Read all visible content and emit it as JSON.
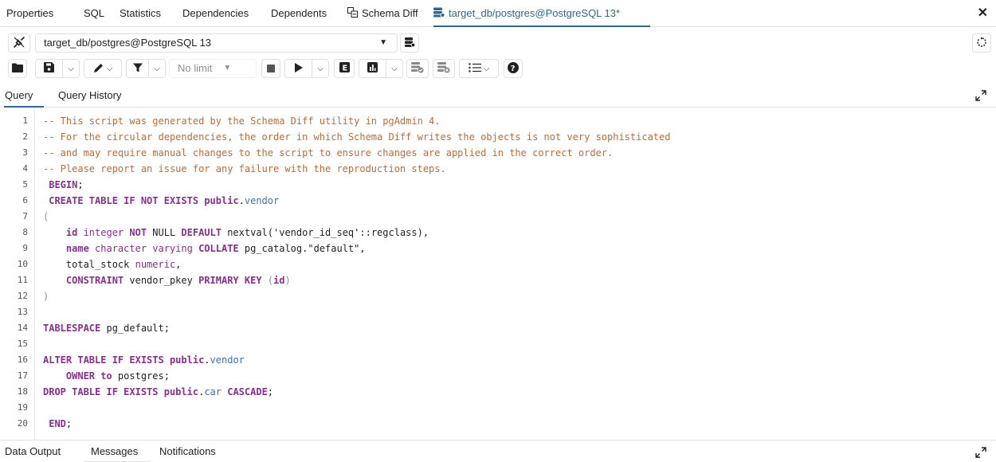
{
  "tabs": [
    {
      "label": "Properties"
    },
    {
      "label": "SQL"
    },
    {
      "label": "Statistics"
    },
    {
      "label": "Dependencies"
    },
    {
      "label": "Dependents"
    },
    {
      "label": "Schema Diff",
      "icon": "schema-diff-icon"
    },
    {
      "label": "target_db/postgres@PostgreSQL 13*",
      "icon": "server-icon",
      "active": true
    }
  ],
  "connection": {
    "selected": "target_db/postgres@PostgreSQL 13"
  },
  "toolbar": {
    "row_limit": "No limit"
  },
  "query_tabs": [
    {
      "label": "Query",
      "active": true
    },
    {
      "label": "Query History"
    }
  ],
  "editor": {
    "line_numbers": [
      "1",
      "2",
      "3",
      "4",
      "5",
      "6",
      "7",
      "8",
      "9",
      "10",
      "11",
      "12",
      "13",
      "14",
      "15",
      "16",
      "17",
      "18",
      "19",
      "20"
    ],
    "lines": [
      {
        "parts": [
          {
            "t": "c",
            "s": "-- This script was generated by the Schema Diff utility in pgAdmin 4."
          }
        ]
      },
      {
        "parts": [
          {
            "t": "c",
            "s": "-- For the circular dependencies, the order in which Schema Diff writes the objects is not very sophisticated"
          }
        ]
      },
      {
        "parts": [
          {
            "t": "c",
            "s": "-- and may require manual changes to the script to ensure changes are applied in the correct order."
          }
        ]
      },
      {
        "parts": [
          {
            "t": "c",
            "s": "-- Please report an issue for any failure with the reproduction steps."
          }
        ]
      },
      {
        "parts": [
          {
            "t": "k",
            "s": " BEGIN"
          },
          {
            "t": "p",
            "s": ";"
          }
        ]
      },
      {
        "parts": [
          {
            "t": "k",
            "s": " CREATE TABLE IF NOT EXISTS public"
          },
          {
            "t": "p",
            "s": "."
          },
          {
            "t": "i",
            "s": "vendor"
          }
        ]
      },
      {
        "parts": [
          {
            "t": "g",
            "s": "("
          }
        ]
      },
      {
        "parts": [
          {
            "t": "k",
            "s": "    id "
          },
          {
            "t": "y",
            "s": "integer "
          },
          {
            "t": "k",
            "s": "NOT "
          },
          {
            "t": "p",
            "s": "NULL "
          },
          {
            "t": "k",
            "s": "DEFAULT "
          },
          {
            "t": "p",
            "s": "nextval('vendor_id_seq'::regclass),"
          }
        ]
      },
      {
        "parts": [
          {
            "t": "k",
            "s": "    name "
          },
          {
            "t": "y",
            "s": "character varying "
          },
          {
            "t": "k",
            "s": "COLLATE "
          },
          {
            "t": "p",
            "s": "pg_catalog.\"default\","
          }
        ]
      },
      {
        "parts": [
          {
            "t": "p",
            "s": "    total_stock "
          },
          {
            "t": "y",
            "s": "numeric"
          },
          {
            "t": "p",
            "s": ","
          }
        ]
      },
      {
        "parts": [
          {
            "t": "k",
            "s": "    CONSTRAINT "
          },
          {
            "t": "p",
            "s": "vendor_pkey "
          },
          {
            "t": "k",
            "s": "PRIMARY KEY "
          },
          {
            "t": "g",
            "s": "("
          },
          {
            "t": "k",
            "s": "id"
          },
          {
            "t": "g",
            "s": ")"
          }
        ]
      },
      {
        "parts": [
          {
            "t": "g",
            "s": ")"
          }
        ]
      },
      {
        "parts": []
      },
      {
        "parts": [
          {
            "t": "k",
            "s": "TABLESPACE "
          },
          {
            "t": "p",
            "s": "pg_default;"
          }
        ]
      },
      {
        "parts": []
      },
      {
        "parts": [
          {
            "t": "k",
            "s": "ALTER TABLE IF EXISTS public"
          },
          {
            "t": "p",
            "s": "."
          },
          {
            "t": "i",
            "s": "vendor"
          }
        ]
      },
      {
        "parts": [
          {
            "t": "k",
            "s": "    OWNER to "
          },
          {
            "t": "p",
            "s": "postgres;"
          }
        ]
      },
      {
        "parts": [
          {
            "t": "k",
            "s": "DROP TABLE IF EXISTS public"
          },
          {
            "t": "p",
            "s": "."
          },
          {
            "t": "i",
            "s": "car "
          },
          {
            "t": "k",
            "s": "CASCADE"
          },
          {
            "t": "p",
            "s": ";"
          }
        ]
      },
      {
        "parts": []
      },
      {
        "parts": [
          {
            "t": "k",
            "s": " END"
          },
          {
            "t": "p",
            "s": ";"
          }
        ]
      }
    ]
  },
  "bottom_tabs": [
    {
      "label": "Data Output"
    },
    {
      "label": "Messages",
      "active": true
    },
    {
      "label": "Notifications"
    }
  ],
  "colors": {
    "accent": "#326690",
    "comment": "#bf6b36",
    "keyword": "#8a2e8f",
    "identifier": "#3b6fb6",
    "border": "#dde0e6"
  }
}
